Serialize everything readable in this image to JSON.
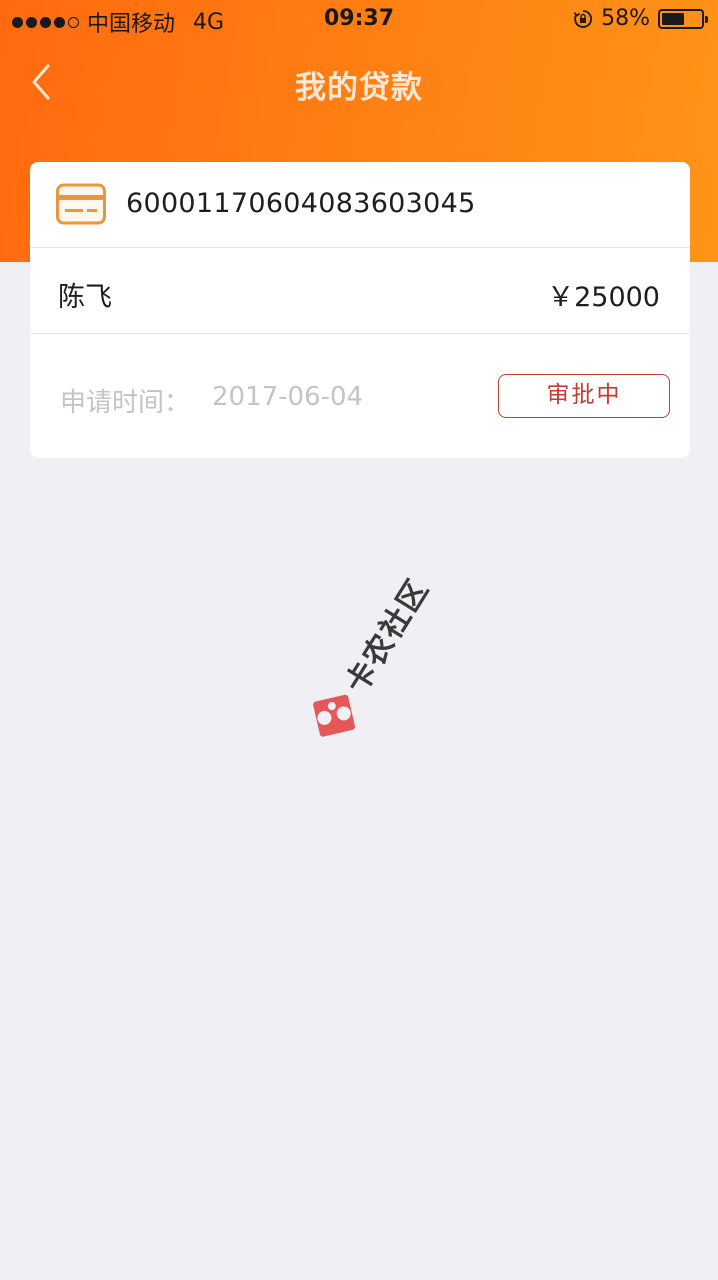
{
  "status_bar": {
    "carrier": "中国移动",
    "network": "4G",
    "time": "09:37",
    "battery_percent": "58%",
    "battery_level": 0.58
  },
  "nav": {
    "title": "我的贷款"
  },
  "loan": {
    "account_number": "60001170604083603045",
    "name": "陈飞",
    "amount": "￥25000",
    "apply_time_label": "申请时间：",
    "apply_date": "2017-06-04",
    "status": "审批中"
  },
  "watermark": {
    "text": "卡农社区"
  },
  "colors": {
    "accent_orange": "#ff7a12",
    "status_red": "#c23c32",
    "background": "#efeff4"
  }
}
